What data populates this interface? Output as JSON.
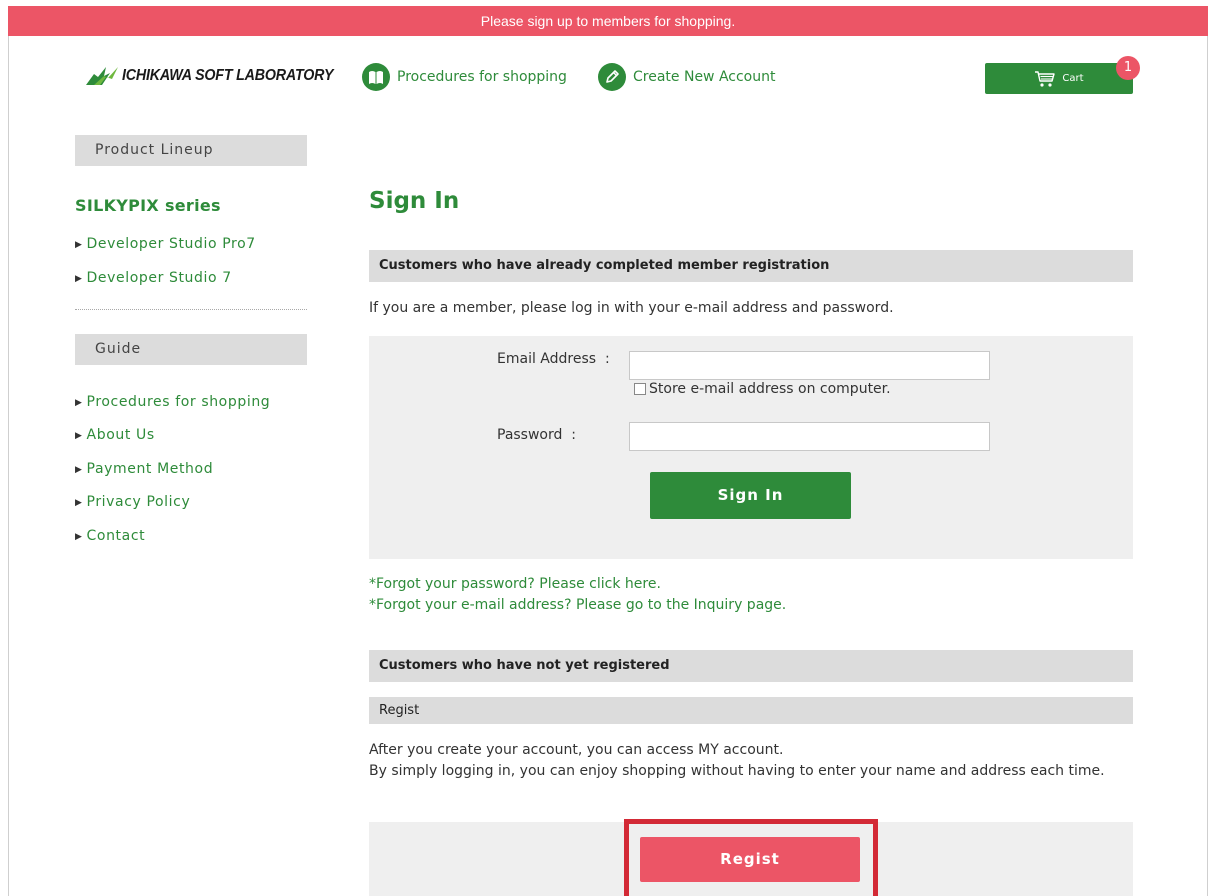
{
  "banner": {
    "text": "Please sign up to members for shopping."
  },
  "header": {
    "logo_text": "ICHIKAWA SOFT LABORATORY",
    "nav": [
      {
        "label": "Procedures for shopping",
        "icon": "book-icon"
      },
      {
        "label": "Create New Account",
        "icon": "pencil-icon"
      }
    ],
    "cart": {
      "label": "Cart",
      "count": "1",
      "icon": "cart-icon"
    }
  },
  "sidebar": {
    "product_heading": "Product Lineup",
    "series_title": "SILKYPIX series",
    "products": [
      {
        "label": "Developer Studio Pro7"
      },
      {
        "label": "Developer Studio 7"
      }
    ],
    "guide_heading": "Guide",
    "guide_links": [
      {
        "label": "Procedures for shopping"
      },
      {
        "label": "About Us"
      },
      {
        "label": "Payment Method"
      },
      {
        "label": "Privacy Policy"
      },
      {
        "label": "Contact"
      }
    ]
  },
  "main": {
    "title": "Sign In",
    "member_section": {
      "heading": "Customers who have already completed member registration",
      "intro": "If you are a member, please log in with your e-mail address and password.",
      "email_label": "Email Address  :",
      "email_value": "",
      "store_label": "Store e-mail address on computer.",
      "password_label": "Password  :",
      "password_value": "",
      "signin_button": "Sign In",
      "forgot_password": "*Forgot your password? Please click here.",
      "forgot_email": "*Forgot your e-mail address? Please go to the Inquiry page."
    },
    "new_section": {
      "heading": "Customers who have not yet registered",
      "sub_heading": "Regist",
      "text_line1": "After you create your account, you can access MY account.",
      "text_line2": "By simply logging in, you can enjoy shopping without having to enter your name and address each time.",
      "regist_button": "Regist"
    }
  },
  "colors": {
    "brand_green": "#2e8b3a",
    "banner_red": "#ec5566",
    "highlight_red": "#d32a36",
    "panel_gray": "#efefef",
    "bar_gray": "#dcdcdc"
  }
}
